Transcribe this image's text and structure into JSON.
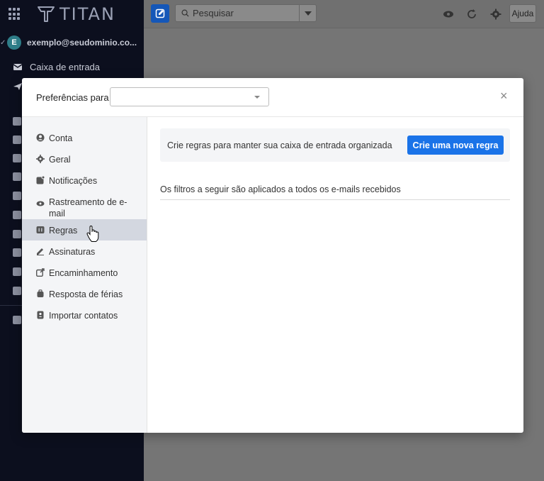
{
  "app": {
    "logo_text": "TITAN"
  },
  "sidebar": {
    "account_initial": "E",
    "account_email": "exemplo@seudominio.co...",
    "items": [
      {
        "label": "Caixa de entrada",
        "icon": "envelope-icon"
      },
      {
        "label": "",
        "icon": "send-icon"
      }
    ]
  },
  "topbar": {
    "search_placeholder": "Pesquisar",
    "help_label": "Ajuda"
  },
  "modal": {
    "title": "Preferências para",
    "selected_account": "",
    "close_glyph": "×",
    "nav": [
      {
        "id": "conta",
        "label": "Conta",
        "icon": "user-circle-icon"
      },
      {
        "id": "geral",
        "label": "Geral",
        "icon": "gear-icon"
      },
      {
        "id": "notificacoes",
        "label": "Notificações",
        "icon": "notification-icon"
      },
      {
        "id": "rastreamento",
        "label": "Rastreamento de e-mail",
        "icon": "eye-icon"
      },
      {
        "id": "regras",
        "label": "Regras",
        "icon": "rules-icon",
        "active": true
      },
      {
        "id": "assinaturas",
        "label": "Assinaturas",
        "icon": "pen-icon"
      },
      {
        "id": "encaminhamento",
        "label": "Encaminhamento",
        "icon": "forward-icon"
      },
      {
        "id": "ferias",
        "label": "Resposta de férias",
        "icon": "suitcase-icon"
      },
      {
        "id": "importar",
        "label": "Importar contatos",
        "icon": "contact-icon"
      }
    ],
    "content": {
      "banner_text": "Crie regras para manter sua caixa de entrada organizada",
      "new_rule_label": "Crie uma nova regra",
      "filters_note": "Os filtros a seguir são aplicados a todos os e-mails recebidos"
    }
  },
  "colors": {
    "sidebar_bg": "#0c0f1e",
    "primary_button": "#1a73e8",
    "active_nav": "#d3d7e0"
  }
}
